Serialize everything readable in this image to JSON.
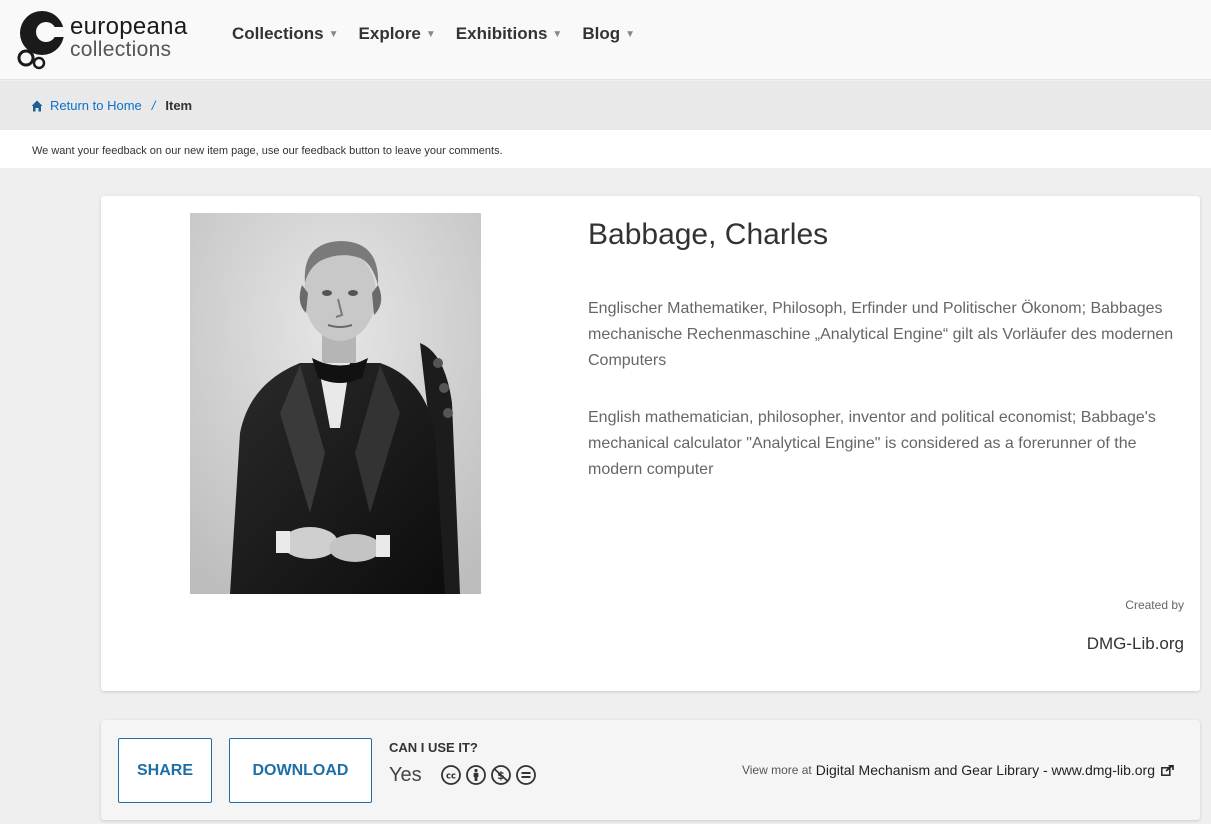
{
  "brand": {
    "name": "europeana",
    "subname": "collections"
  },
  "nav": {
    "items": [
      {
        "label": "Collections"
      },
      {
        "label": "Explore"
      },
      {
        "label": "Exhibitions"
      },
      {
        "label": "Blog"
      }
    ],
    "caret_icon": "chevron-down-icon"
  },
  "breadcrumb": {
    "home_label": "Return to Home",
    "separator": "/",
    "current": "Item"
  },
  "feedback": {
    "text": "We want your feedback on our new item page, use our feedback button to leave your comments."
  },
  "item": {
    "title": "Babbage, Charles",
    "description_de": "Englischer Mathematiker, Philosoph, Erfinder und Politischer Ökonom; Babbages mechanische Rechenmaschine „Analytical Engine“ gilt als Vorläufer des modernen Computers",
    "description_en": "English mathematician, philosopher, inventor and political economist; Babbage's mechanical calculator \"Analytical Engine\" is considered as a forerunner of the modern computer",
    "created_by_label": "Created by",
    "created_by_value": "DMG-Lib.org"
  },
  "actions": {
    "share_label": "SHARE",
    "download_label": "DOWNLOAD",
    "can_use_label": "CAN I USE IT?",
    "can_use_value": "Yes",
    "license_icons": [
      "cc-icon",
      "attribution-icon",
      "noncommercial-icon",
      "noderivatives-icon"
    ],
    "view_more_prefix": "View more at",
    "view_more_link": "Digital Mechanism and Gear Library - www.dmg-lib.org"
  },
  "colors": {
    "link_blue": "#0a72cc",
    "button_blue": "#1f6fa7",
    "page_bg": "#efefef"
  }
}
